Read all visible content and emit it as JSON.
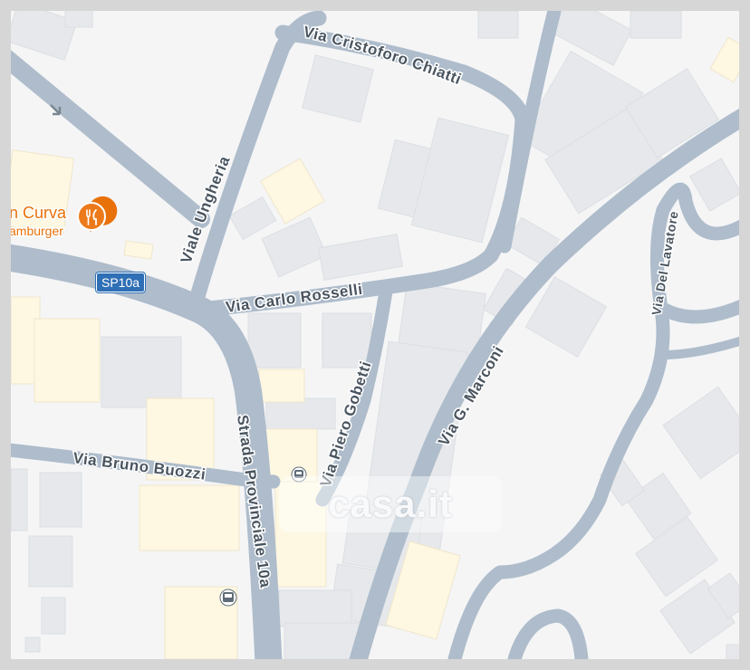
{
  "map": {
    "colors": {
      "background": "#f5f5f6",
      "road": "#aebccb",
      "building": "#e6e8eb",
      "building_highlight": "#fef7e2",
      "poi": "#e8710a",
      "shield": "#2f6fb5"
    },
    "streets": {
      "via_cristoforo_chiatti": "Via Cristoforo Chiatti",
      "viale_ungheria": "Viale Ungheria",
      "via_carlo_rosselli": "Via Carlo Rosselli",
      "via_piero_gobetti": "Via Piero Gobetti",
      "via_g_marconi": "Via G. Marconi",
      "via_del_lavatore": "Via Del Lavatore",
      "via_bruno_buozzi": "Via Bruno Buozzi",
      "strada_provinciale_10a": "Strada Provinciale 10a"
    },
    "road_shield": "SP10a",
    "poi": {
      "name": "n Curva",
      "category": "amburger",
      "icon": "restaurant-icon"
    },
    "transit_icon": "bus-stop-icon",
    "watermark": "casa.it"
  }
}
